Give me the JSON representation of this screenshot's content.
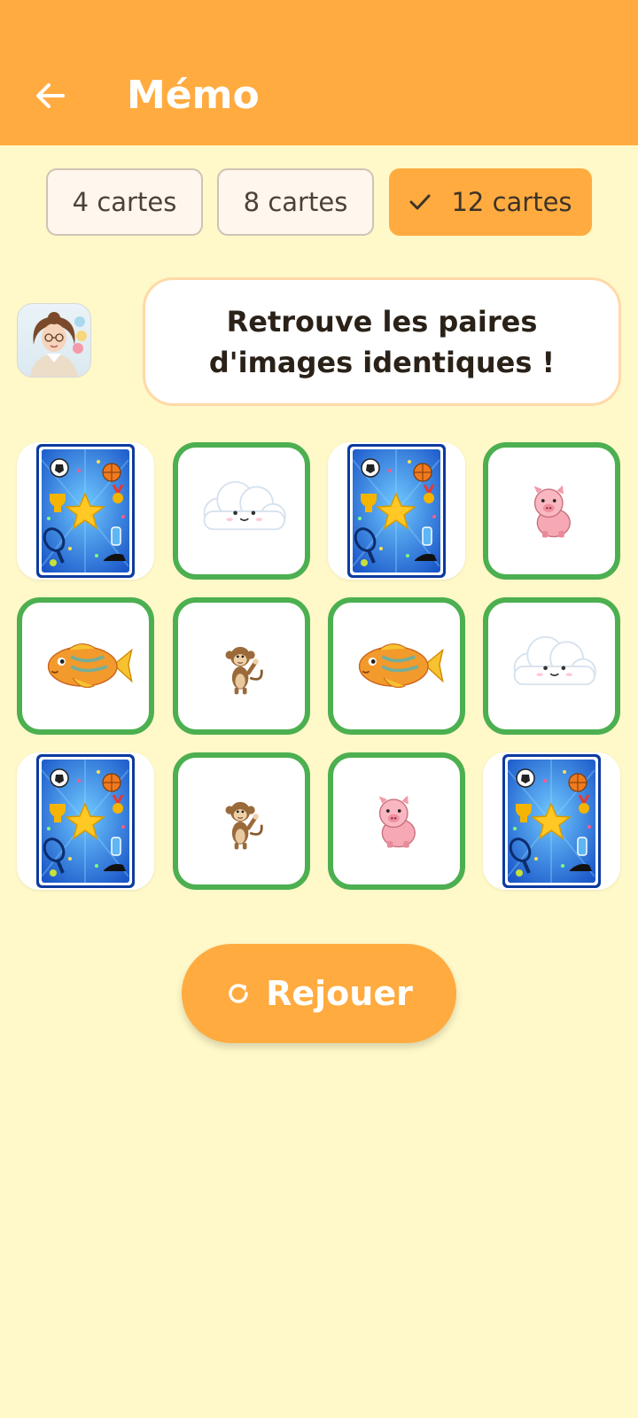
{
  "header": {
    "title": "Mémo",
    "back_icon": "arrow-left-icon"
  },
  "modes": [
    {
      "label": "4 cartes",
      "selected": false
    },
    {
      "label": "8 cartes",
      "selected": false
    },
    {
      "label": "12 cartes",
      "selected": true
    }
  ],
  "instruction": "Retrouve les paires d'images identiques !",
  "board": {
    "cards": [
      {
        "state": "face-down",
        "image": "card-back-icon"
      },
      {
        "state": "matched",
        "image": "cloud-icon"
      },
      {
        "state": "face-down",
        "image": "card-back-icon"
      },
      {
        "state": "matched",
        "image": "pig-icon"
      },
      {
        "state": "matched",
        "image": "fish-icon"
      },
      {
        "state": "matched",
        "image": "monkey-icon"
      },
      {
        "state": "matched",
        "image": "fish-icon"
      },
      {
        "state": "matched",
        "image": "cloud-icon"
      },
      {
        "state": "face-down",
        "image": "card-back-icon"
      },
      {
        "state": "matched",
        "image": "monkey-icon"
      },
      {
        "state": "matched",
        "image": "pig-icon"
      },
      {
        "state": "face-down",
        "image": "card-back-icon"
      }
    ]
  },
  "replay": {
    "label": "Rejouer",
    "icon": "refresh-icon"
  },
  "colors": {
    "appbar": "#FFAB40",
    "background": "#FFF8C8",
    "matched_border": "#4CAF50",
    "card_back": "#1E6FE0"
  }
}
